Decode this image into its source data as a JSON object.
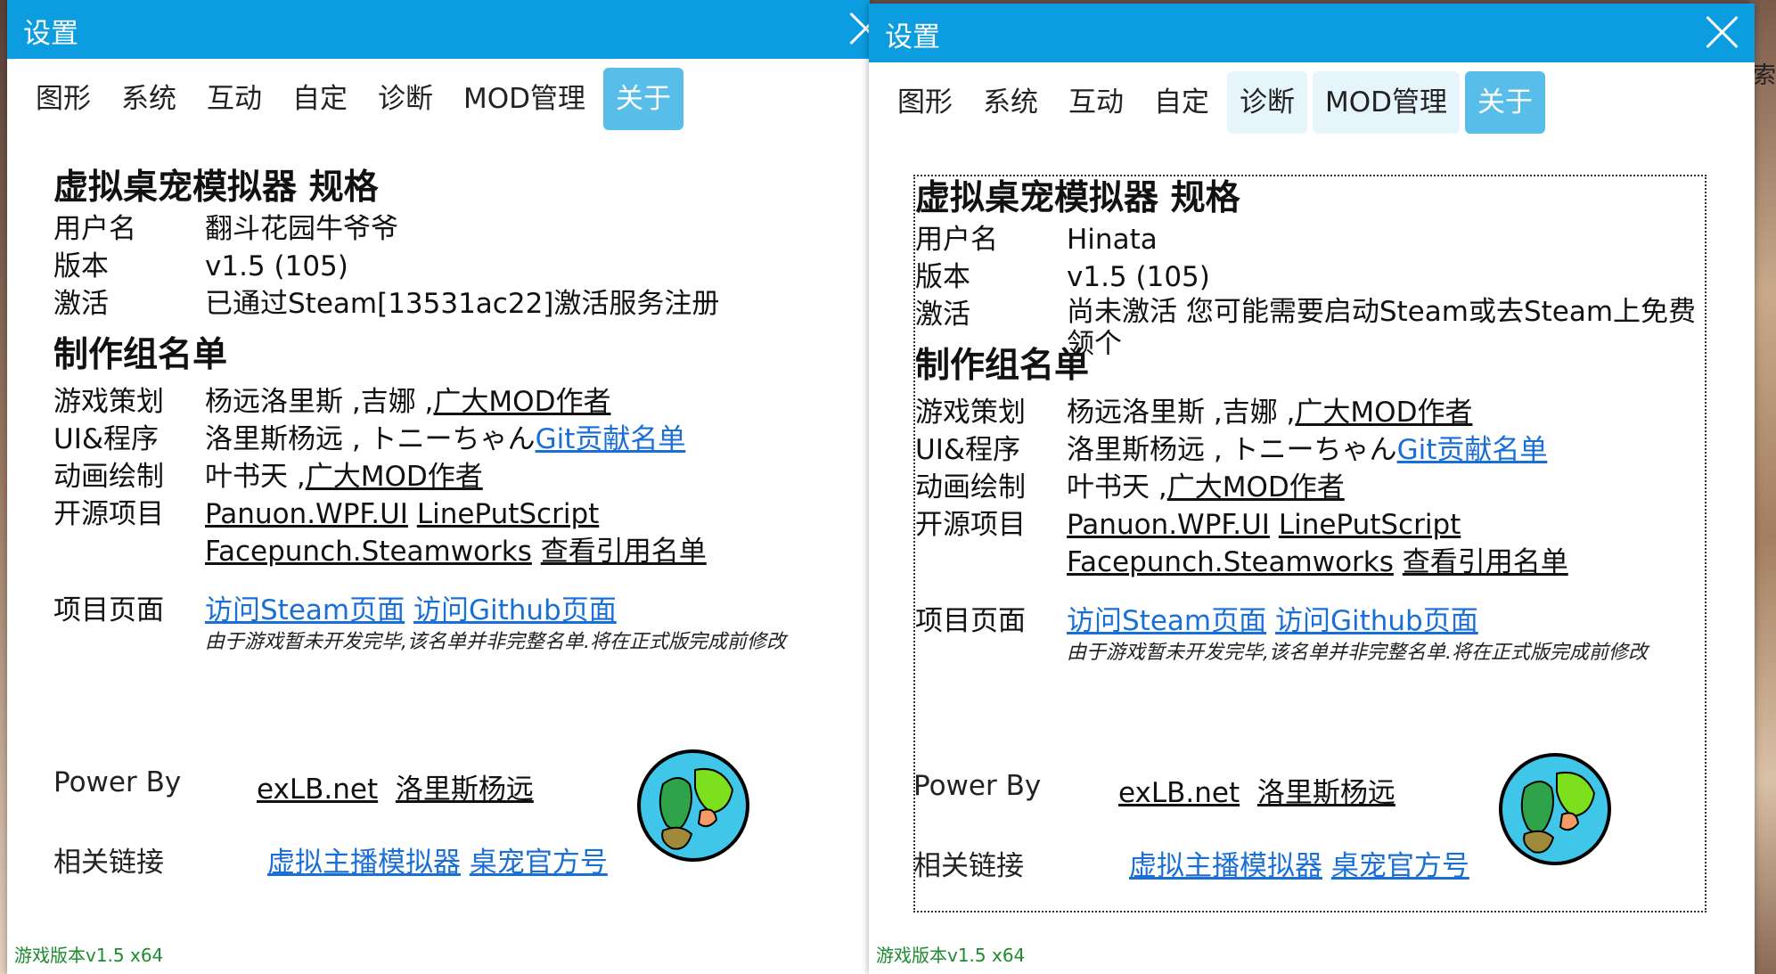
{
  "background": {
    "side_text": "索"
  },
  "windows": [
    {
      "title": "设置",
      "tabs": [
        "图形",
        "系统",
        "互动",
        "自定",
        "诊断",
        "MOD管理",
        "关于"
      ],
      "active_tab": "关于",
      "spec_title": "虚拟桌宠模拟器 规格",
      "user_label": "用户名",
      "user_value": "翻斗花园牛爷爷",
      "version_label": "版本",
      "version_value": "v1.5 (105)",
      "activation_label": "激活",
      "activation_value": "已通过Steam[13531ac22]激活服务注册",
      "credits_title": "制作组名单",
      "design_label": "游戏策划",
      "design_value": "杨远洛里斯 ,吉娜 ,",
      "design_link": "广大MOD作者",
      "ui_label": "UI&程序",
      "ui_value": "洛里斯杨远 , トニーちゃん",
      "ui_link": "Git贡献名单",
      "anim_label": "动画绘制",
      "anim_value": "叶书天 ,",
      "anim_link": "广大MOD作者",
      "oss_label": "开源项目",
      "oss_links": [
        "Panuon.WPF.UI",
        "LinePutScript",
        "Facepunch.Steamworks",
        "查看引用名单"
      ],
      "page_label": "项目页面",
      "page_links": [
        "访问Steam页面",
        "访问Github页面"
      ],
      "note": "由于游戏暂未开发完毕,该名单并非完整名单.将在正式版完成前修改",
      "power_label": "Power By",
      "power_links": [
        "exLB.net",
        "洛里斯杨远"
      ],
      "related_label": "相关链接",
      "related_links": [
        "虚拟主播模拟器",
        "桌宠官方号"
      ],
      "game_version": "游戏版本v1.5 x64"
    },
    {
      "title": "设置",
      "tabs": [
        "图形",
        "系统",
        "互动",
        "自定",
        "诊断",
        "MOD管理",
        "关于"
      ],
      "active_tab": "关于",
      "spec_title": "虚拟桌宠模拟器 规格",
      "user_label": "用户名",
      "user_value": "Hinata",
      "version_label": "版本",
      "version_value": "v1.5 (105)",
      "activation_label": "激活",
      "activation_value": "尚未激活 您可能需要启动Steam或去Steam上免费领个",
      "credits_title": "制作组名单",
      "design_label": "游戏策划",
      "design_value": "杨远洛里斯 ,吉娜 ,",
      "design_link": "广大MOD作者",
      "ui_label": "UI&程序",
      "ui_value": "洛里斯杨远 , トニーちゃん",
      "ui_link": "Git贡献名单",
      "anim_label": "动画绘制",
      "anim_value": "叶书天 ,",
      "anim_link": "广大MOD作者",
      "oss_label": "开源项目",
      "oss_links": [
        "Panuon.WPF.UI",
        "LinePutScript",
        "Facepunch.Steamworks",
        "查看引用名单"
      ],
      "page_label": "项目页面",
      "page_links": [
        "访问Steam页面",
        "访问Github页面"
      ],
      "note": "由于游戏暂未开发完毕,该名单并非完整名单.将在正式版完成前修改",
      "power_label": "Power By",
      "power_links": [
        "exLB.net",
        "洛里斯杨远"
      ],
      "related_label": "相关链接",
      "related_links": [
        "虚拟主播模拟器",
        "桌宠官方号"
      ],
      "game_version": "游戏版本v1.5 x64"
    }
  ]
}
